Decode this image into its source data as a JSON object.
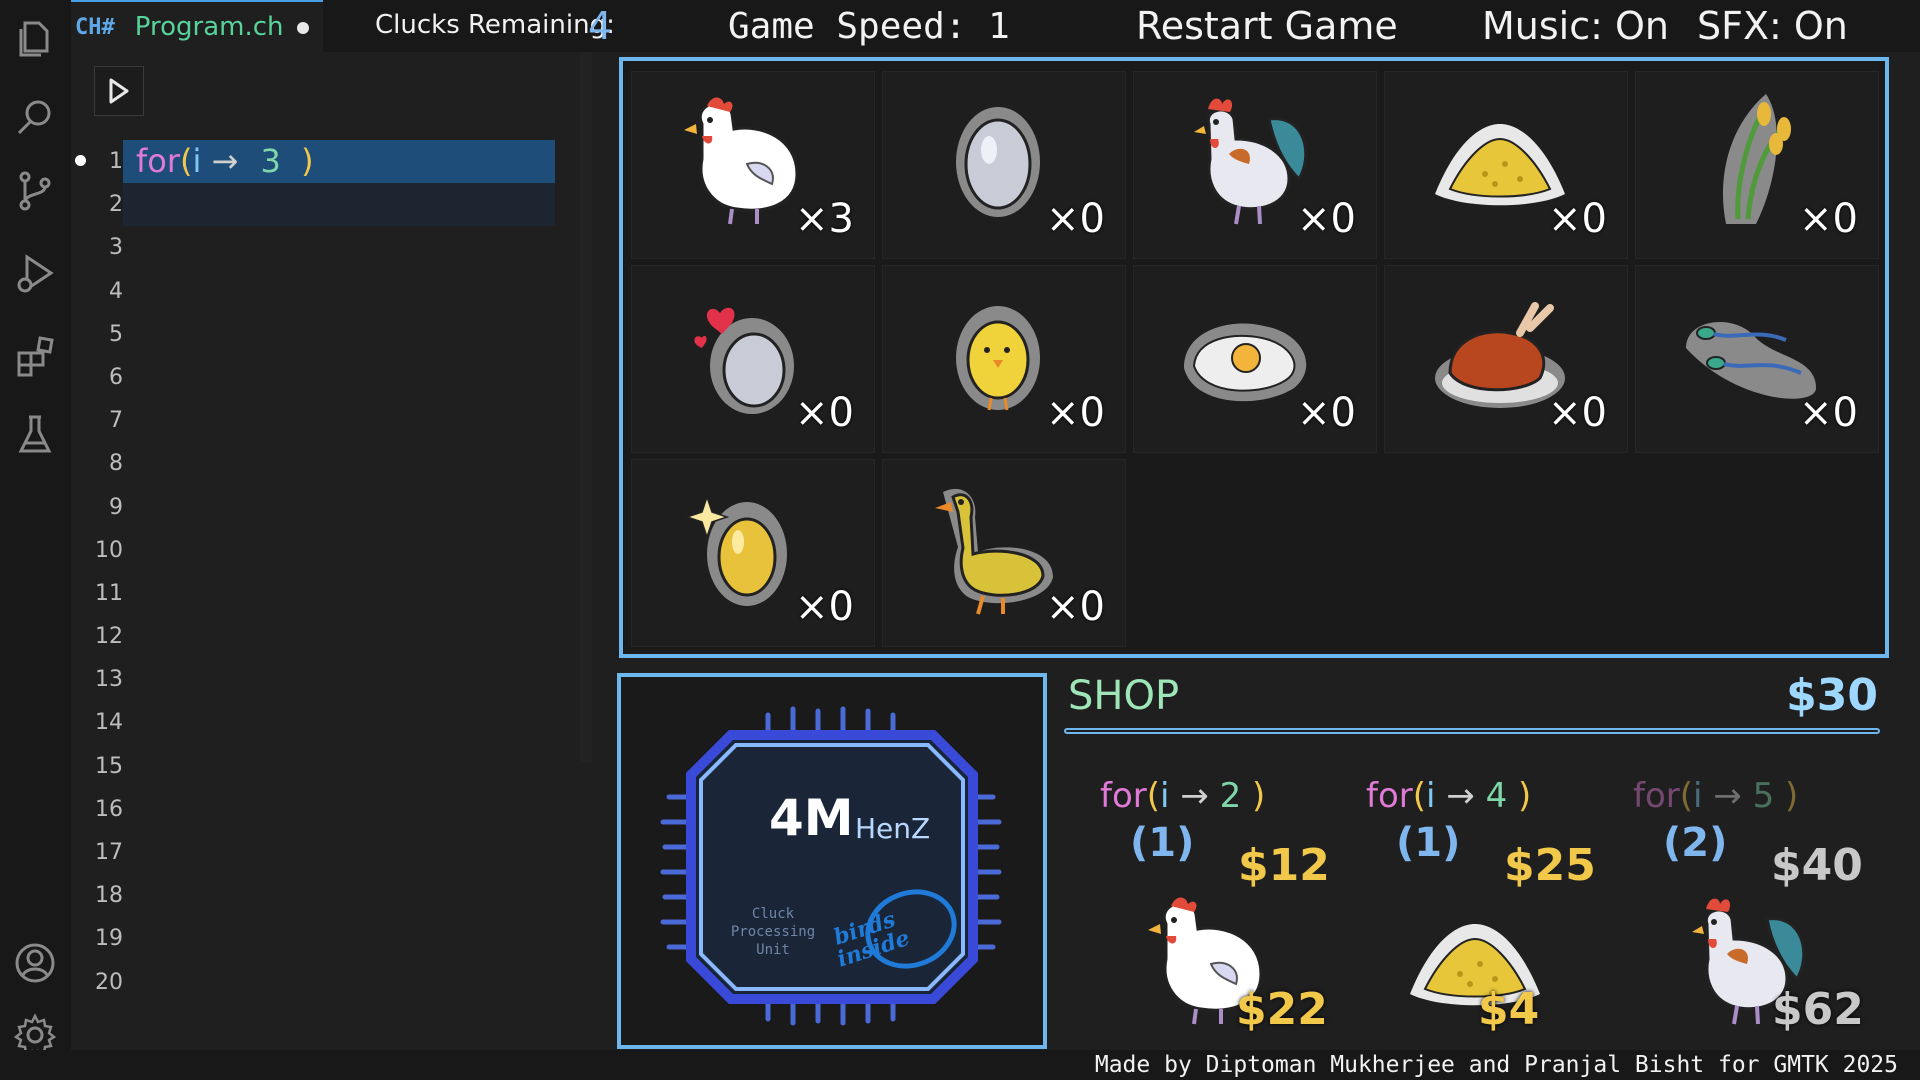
{
  "tab": {
    "icon": "CH#",
    "filename": "Program.ch"
  },
  "topbar": {
    "clucks_label": "Clucks Remaining:",
    "clucks_value": "4",
    "speed_label": "Game Speed: 1",
    "restart_label": "Restart Game",
    "music_label": "Music: On",
    "sfx_label": "SFX: On"
  },
  "editor": {
    "line_numbers": [
      "1",
      "2",
      "3",
      "4",
      "5",
      "6",
      "7",
      "8",
      "9",
      "10",
      "11",
      "12",
      "13",
      "14",
      "15",
      "16",
      "17",
      "18",
      "19",
      "20"
    ],
    "line1": {
      "kw": "for",
      "open": "(",
      "var": "i",
      "arrow": "→",
      "num": "3",
      "close": ")"
    }
  },
  "inventory": [
    {
      "icon": "hen-icon",
      "count": "×3"
    },
    {
      "icon": "egg-icon",
      "count": "×0"
    },
    {
      "icon": "rooster-icon",
      "count": "×0"
    },
    {
      "icon": "grain-pile-icon",
      "count": "×0"
    },
    {
      "icon": "wheat-icon",
      "count": "×0"
    },
    {
      "icon": "fertilized-egg-icon",
      "count": "×0"
    },
    {
      "icon": "chick-icon",
      "count": "×0"
    },
    {
      "icon": "fried-egg-icon",
      "count": "×0"
    },
    {
      "icon": "roast-chicken-icon",
      "count": "×0"
    },
    {
      "icon": "sperm-icon",
      "count": "×0"
    },
    {
      "icon": "golden-egg-icon",
      "count": "×0"
    },
    {
      "icon": "duck-icon",
      "count": "×0"
    }
  ],
  "cpu": {
    "speed_value": "4M",
    "speed_unit": "HenZ",
    "subtitle": [
      "Cluck",
      "Processing",
      "Unit"
    ],
    "logo_text": [
      "birds",
      "inside"
    ]
  },
  "shop": {
    "title": "SHOP",
    "money": "$30",
    "upgrades": [
      {
        "kw": "for",
        "open": "(",
        "var": "i",
        "arrow": "→",
        "num": "2",
        "close": ")",
        "qty": "(1)",
        "price": "$12",
        "affordable": true
      },
      {
        "kw": "for",
        "open": "(",
        "var": "i",
        "arrow": "→",
        "num": "4",
        "close": ")",
        "qty": "(1)",
        "price": "$25",
        "affordable": true
      },
      {
        "kw": "for",
        "open": "(",
        "var": "i",
        "arrow": "→",
        "num": "5",
        "close": ")",
        "qty": "(2)",
        "price": "$40",
        "affordable": false
      }
    ],
    "items": [
      {
        "icon": "hen-icon",
        "price": "$22",
        "affordable": true
      },
      {
        "icon": "grain-pile-icon",
        "price": "$4",
        "affordable": true
      },
      {
        "icon": "rooster-icon",
        "price": "$62",
        "affordable": false
      }
    ]
  },
  "colors": {
    "accent": "#6eb6ee",
    "price_gold": "#f2c84b",
    "keyword": "#e07ad6",
    "selection": "#1f4d7a"
  },
  "footer": {
    "credits": "Made by Diptoman Mukherjee and Pranjal Bisht for GMTK 2025"
  }
}
